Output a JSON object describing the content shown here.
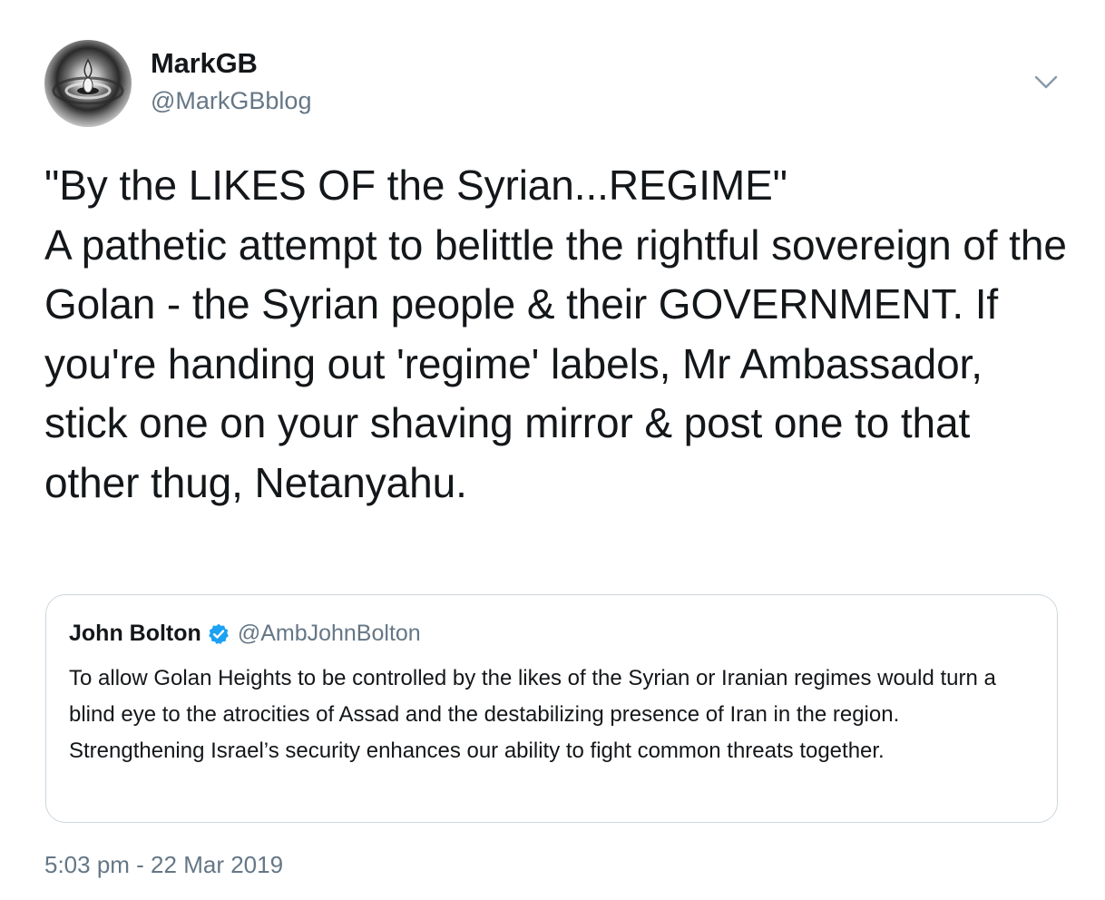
{
  "author": {
    "display_name": "MarkGB",
    "handle": "@MarkGBblog",
    "avatar_icon": "water-drop-avatar"
  },
  "menu": {
    "caret_icon": "chevron-down-icon"
  },
  "tweet": {
    "text": "\"By the LIKES OF the Syrian...REGIME\"\nA pathetic attempt to belittle the rightful sovereign of the Golan - the Syrian people & their GOVERNMENT. If you're handing out 'regime' labels, Mr Ambassador, stick one on your shaving mirror & post one to that other thug, Netanyahu.",
    "timestamp": "5:03 pm - 22 Mar 2019"
  },
  "quoted_tweet": {
    "display_name": "John Bolton",
    "handle": "@AmbJohnBolton",
    "verified": true,
    "text": "To allow Golan Heights to be controlled by the likes of the Syrian or Iranian regimes would turn a blind eye to the atrocities of Assad and the destabilizing presence of Iran in the region. Strengthening Israel’s security enhances our ability to fight common threats together."
  },
  "colors": {
    "text": "#14171a",
    "secondary": "#657786",
    "border": "#ccd6dd",
    "verified": "#1da1f2"
  }
}
